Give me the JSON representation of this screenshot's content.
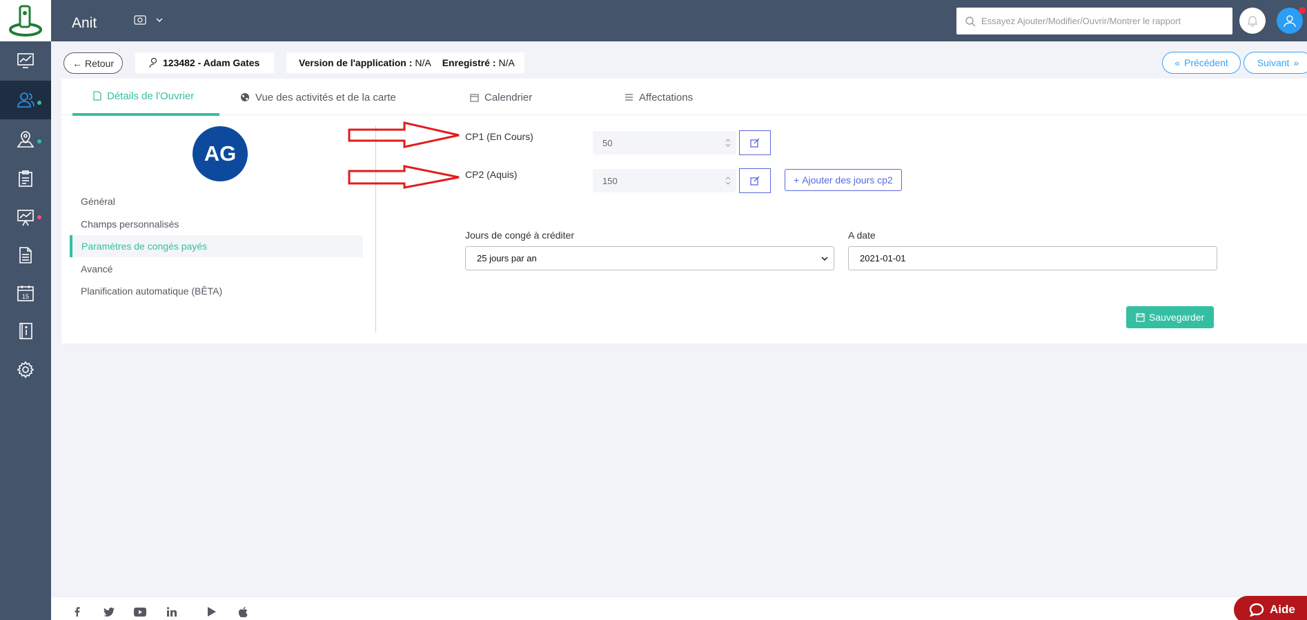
{
  "header": {
    "app_title": "Anit",
    "search_placeholder": "Essayez Ajouter/Modifier/Ouvrir/Montrer le rapport",
    "currency_icon": "money-icon"
  },
  "sidebar": {
    "items": [
      {
        "name": "dashboard",
        "icon": "monitor-chart-icon"
      },
      {
        "name": "workers",
        "icon": "users-icon",
        "active": true,
        "dot": "#34bfa3"
      },
      {
        "name": "map",
        "icon": "map-pin-icon",
        "dot": "#34bfa3"
      },
      {
        "name": "clipboard",
        "icon": "clipboard-icon"
      },
      {
        "name": "reports",
        "icon": "presentation-chart-icon",
        "dot": "#f4516c"
      },
      {
        "name": "documents",
        "icon": "document-icon"
      },
      {
        "name": "calendar",
        "icon": "calendar-icon",
        "badge": "15"
      },
      {
        "name": "info",
        "icon": "info-book-icon"
      },
      {
        "name": "settings",
        "icon": "gear-icon"
      }
    ]
  },
  "subheader": {
    "back_label": "Retour",
    "worker_label": "123482 - Adam Gates",
    "version_label": "Version de l'application :",
    "version_value": "N/A",
    "registered_label": "Enregistré :",
    "registered_value": "N/A",
    "prev_label": "Précédent",
    "next_label": "Suivant"
  },
  "tabs": [
    {
      "label": "Détails de l'Ouvrier",
      "active": true
    },
    {
      "label": "Vue des activités et de la carte"
    },
    {
      "label": "Calendrier"
    },
    {
      "label": "Affectations"
    }
  ],
  "profile": {
    "initials": "AG",
    "menu": [
      {
        "label": "Général"
      },
      {
        "label": "Champs personnalisés"
      },
      {
        "label": "Paramètres de congés payés",
        "active": true
      },
      {
        "label": "Avancé"
      },
      {
        "label": "Planification automatique (BÊTA)"
      }
    ]
  },
  "form": {
    "cp1_label": "CP1 (En Cours)",
    "cp1_value": "50",
    "cp2_label": "CP2 (Aquis)",
    "cp2_value": "150",
    "add_cp2_label": "Ajouter des jours cp2",
    "days_label": "Jours de congé à créditer",
    "days_value": "25 jours par an",
    "date_label": "A date",
    "date_value": "2021-01-01",
    "save_label": "Sauvegarder"
  },
  "footer": {
    "aide_label": "Aide"
  },
  "colors": {
    "sidebar": "#44546a",
    "accent": "#34bfa3",
    "primary": "#5867dd",
    "info": "#36a3f7",
    "annotation_arrow": "#e31b1b"
  }
}
